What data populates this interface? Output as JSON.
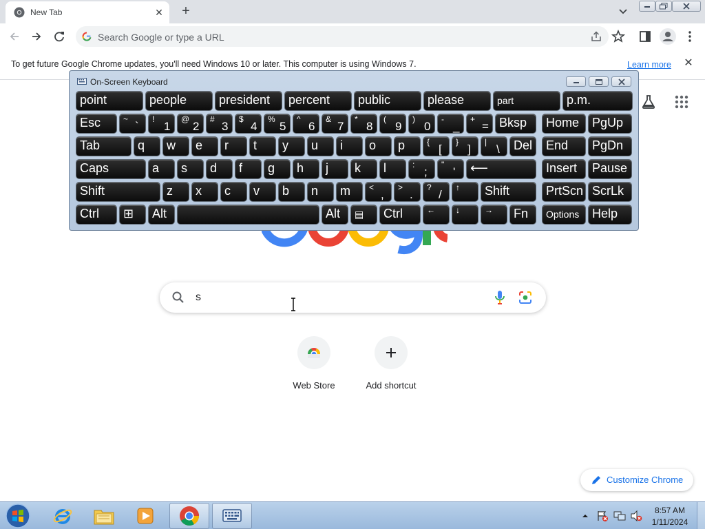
{
  "browser": {
    "tab_title": "New Tab",
    "tab_close": "✕",
    "new_tab": "+",
    "omnibox_placeholder": "Search Google or type a URL",
    "icons": [
      "chrome-icon",
      "chevron-down-icon",
      "back-icon",
      "forward-icon",
      "reload-icon",
      "google-g-icon",
      "share-icon",
      "star-icon",
      "side-panel-icon",
      "profile-icon",
      "more-icon"
    ]
  },
  "infobar": {
    "message": "To get future Google Chrome updates, you'll need Windows 10 or later. This computer is using Windows 7.",
    "link": "Learn more",
    "close": "✕"
  },
  "ntp": {
    "search_value": "s",
    "shortcuts": [
      {
        "label": "Web Store",
        "icon": "web-store-icon"
      },
      {
        "label": "Add shortcut",
        "icon": "plus-icon",
        "glyph": "+"
      }
    ],
    "customize_label": "Customize Chrome",
    "colors": {
      "blue": "#4285f4",
      "red": "#ea4335",
      "yellow": "#fbbc05",
      "green": "#34a853",
      "link": "#1a73e8"
    }
  },
  "osk": {
    "title": "On-Screen Keyboard",
    "rows": [
      [
        {
          "l": "point",
          "w": 98
        },
        {
          "l": "people",
          "w": 98
        },
        {
          "l": "president",
          "w": 98
        },
        {
          "l": "percent",
          "w": 98
        },
        {
          "l": "public",
          "w": 98
        },
        {
          "l": "please",
          "w": 98
        },
        {
          "l": "part",
          "w": 98,
          "small": true
        },
        {
          "l": "p.m.",
          "w": 102
        }
      ],
      [
        {
          "l": "Esc",
          "w": 60
        },
        {
          "t": "~",
          "b": "`",
          "w": 39
        },
        {
          "t": "!",
          "b": "1",
          "w": 39
        },
        {
          "t": "@",
          "b": "2",
          "w": 39
        },
        {
          "t": "#",
          "b": "3",
          "w": 39
        },
        {
          "t": "$",
          "b": "4",
          "w": 39
        },
        {
          "t": "%",
          "b": "5",
          "w": 39
        },
        {
          "t": "^",
          "b": "6",
          "w": 39
        },
        {
          "t": "&",
          "b": "7",
          "w": 39
        },
        {
          "t": "*",
          "b": "8",
          "w": 39
        },
        {
          "t": "(",
          "b": "9",
          "w": 39
        },
        {
          "t": ")",
          "b": "0",
          "w": 39
        },
        {
          "t": "-",
          "b": "_",
          "w": 39
        },
        {
          "t": "+",
          "b": "=",
          "w": 39
        },
        {
          "l": "Bksp",
          "w": 60
        },
        {
          "gap": 5
        },
        {
          "l": "Home",
          "w": 64
        },
        {
          "l": "PgUp",
          "w": 64
        }
      ],
      [
        {
          "l": "Tab",
          "w": 81
        },
        {
          "l": "q",
          "w": 39
        },
        {
          "l": "w",
          "w": 39
        },
        {
          "l": "e",
          "w": 39
        },
        {
          "l": "r",
          "w": 39
        },
        {
          "l": "t",
          "w": 39
        },
        {
          "l": "y",
          "w": 39
        },
        {
          "l": "u",
          "w": 39
        },
        {
          "l": "i",
          "w": 39
        },
        {
          "l": "o",
          "w": 39
        },
        {
          "l": "p",
          "w": 39
        },
        {
          "t": "{",
          "b": "[",
          "w": 39
        },
        {
          "t": "}",
          "b": "]",
          "w": 39
        },
        {
          "t": "|",
          "b": "\\",
          "w": 39
        },
        {
          "l": "Del",
          "w": 39
        },
        {
          "gap": 5
        },
        {
          "l": "End",
          "w": 64
        },
        {
          "l": "PgDn",
          "w": 64
        }
      ],
      [
        {
          "l": "Caps",
          "w": 102
        },
        {
          "l": "a",
          "w": 39
        },
        {
          "l": "s",
          "w": 39
        },
        {
          "l": "d",
          "w": 39
        },
        {
          "l": "f",
          "w": 39
        },
        {
          "l": "g",
          "w": 39
        },
        {
          "l": "h",
          "w": 39
        },
        {
          "l": "j",
          "w": 39
        },
        {
          "l": "k",
          "w": 39
        },
        {
          "l": "l",
          "w": 39
        },
        {
          "t": ":",
          "b": ";",
          "w": 39
        },
        {
          "t": "\"",
          "b": "'",
          "w": 39
        },
        {
          "l": "⟵",
          "w": 102
        },
        {
          "gap": 5
        },
        {
          "l": "Insert",
          "w": 64
        },
        {
          "l": "Pause",
          "w": 64
        }
      ],
      [
        {
          "l": "Shift",
          "w": 123
        },
        {
          "l": "z",
          "w": 39
        },
        {
          "l": "x",
          "w": 39
        },
        {
          "l": "c",
          "w": 39
        },
        {
          "l": "v",
          "w": 39
        },
        {
          "l": "b",
          "w": 39
        },
        {
          "l": "n",
          "w": 39
        },
        {
          "l": "m",
          "w": 39
        },
        {
          "t": "<",
          "b": ",",
          "w": 39
        },
        {
          "t": ">",
          "b": ".",
          "w": 39
        },
        {
          "t": "?",
          "b": "/",
          "w": 39
        },
        {
          "t": "↑",
          "b": "",
          "w": 39
        },
        {
          "l": "Shift",
          "w": 81
        },
        {
          "gap": 5
        },
        {
          "l": "PrtScn",
          "w": 64
        },
        {
          "l": "ScrLk",
          "w": 64
        }
      ],
      [
        {
          "l": "Ctrl",
          "w": 60
        },
        {
          "l": "⊞",
          "w": 39,
          "icon": "windows-key-icon"
        },
        {
          "l": "Alt",
          "w": 39
        },
        {
          "l": "",
          "w": 207
        },
        {
          "l": "Alt",
          "w": 39
        },
        {
          "l": "▤",
          "w": 39,
          "icon": "menu-key-icon",
          "small": true
        },
        {
          "l": "Ctrl",
          "w": 60
        },
        {
          "t": "←",
          "b": "",
          "w": 39
        },
        {
          "t": "↓",
          "b": "",
          "w": 39
        },
        {
          "t": "→",
          "b": "",
          "w": 39
        },
        {
          "l": "Fn",
          "w": 39
        },
        {
          "gap": 5
        },
        {
          "l": "Options",
          "w": 64,
          "small": true
        },
        {
          "l": "Help",
          "w": 64
        }
      ]
    ]
  },
  "taskbar": {
    "time": "8:57 AM",
    "date": "1/11/2024",
    "pinned": [
      "internet-explorer-icon",
      "windows-explorer-icon",
      "media-player-icon",
      "chrome-icon",
      "on-screen-keyboard-icon"
    ],
    "tray": [
      "show-hidden-icons-icon",
      "action-center-icon",
      "network-icon",
      "volume-muted-icon"
    ]
  }
}
